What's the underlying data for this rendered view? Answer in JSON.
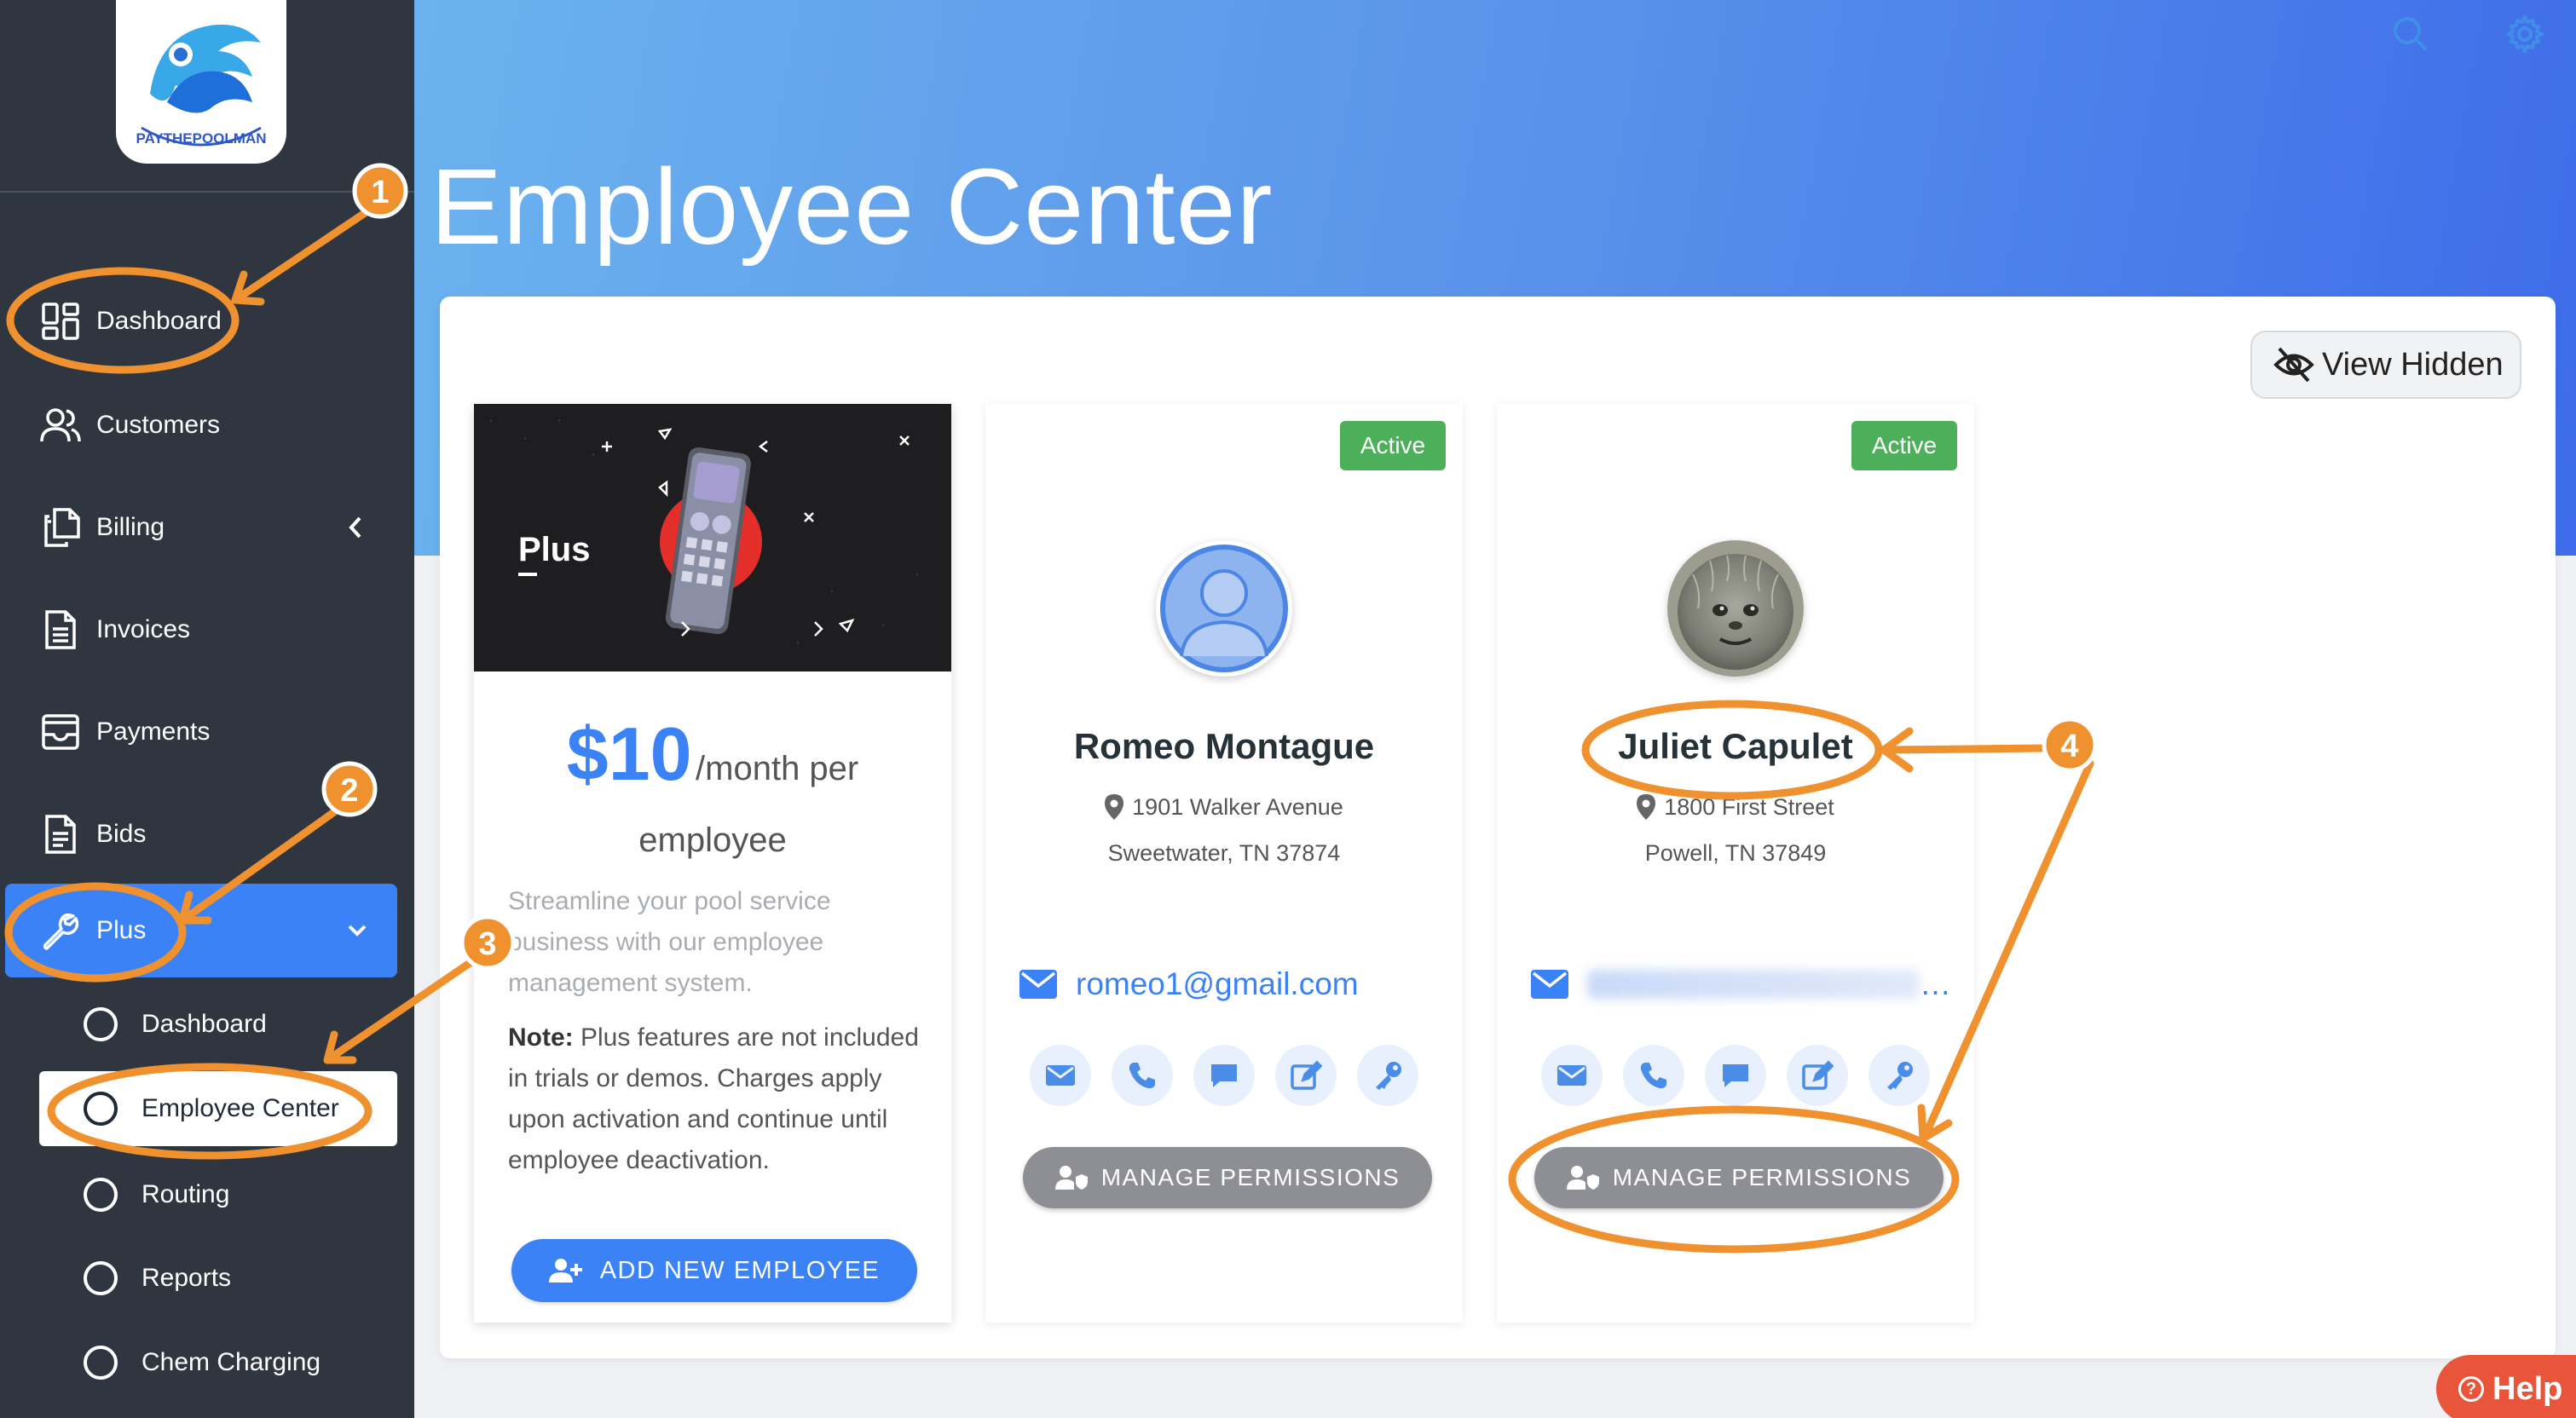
{
  "sidebar": {
    "logo_text": "PAYTHEPOOLMAN",
    "items": [
      {
        "label": "Dashboard"
      },
      {
        "label": "Customers"
      },
      {
        "label": "Billing"
      },
      {
        "label": "Invoices"
      },
      {
        "label": "Payments"
      },
      {
        "label": "Bids"
      },
      {
        "label": "Plus"
      }
    ],
    "subitems": [
      {
        "label": "Dashboard"
      },
      {
        "label": "Employee Center"
      },
      {
        "label": "Routing"
      },
      {
        "label": "Reports"
      },
      {
        "label": "Chem Charging"
      }
    ]
  },
  "header": {
    "title": "Employee Center"
  },
  "toolbar": {
    "view_hidden_label": "View Hidden"
  },
  "plus_card": {
    "banner_text": "Plus",
    "price": "$10",
    "price_unit": "/month per",
    "price_unit2": "employee",
    "description": "Streamline your pool service business with our employee management system.",
    "note_label": "Note:",
    "note_text": " Plus features are not included in trials or demos. Charges apply upon activation and continue until employee deactivation.",
    "add_button_label": "ADD NEW EMPLOYEE"
  },
  "employees": [
    {
      "status": "Active",
      "name": "Romeo Montague",
      "address_line1": "1901 Walker Avenue",
      "address_line2": "Sweetwater, TN 37874",
      "email": "romeo1@gmail.com",
      "manage_label": "MANAGE PERMISSIONS"
    },
    {
      "status": "Active",
      "name": "Juliet Capulet",
      "address_line1": "1800 First Street",
      "address_line2": "Powell, TN 37849",
      "email": "…",
      "manage_label": "MANAGE PERMISSIONS"
    }
  ],
  "help_label": "Help",
  "annotations": {
    "steps": [
      "1",
      "2",
      "3",
      "4"
    ],
    "color": "#f0912f"
  },
  "colors": {
    "sidebar": "#2f3640",
    "accent": "#3b82f6",
    "active_badge": "#4cb05a",
    "manage_button": "#8e8f94",
    "help": "#e8553a"
  }
}
